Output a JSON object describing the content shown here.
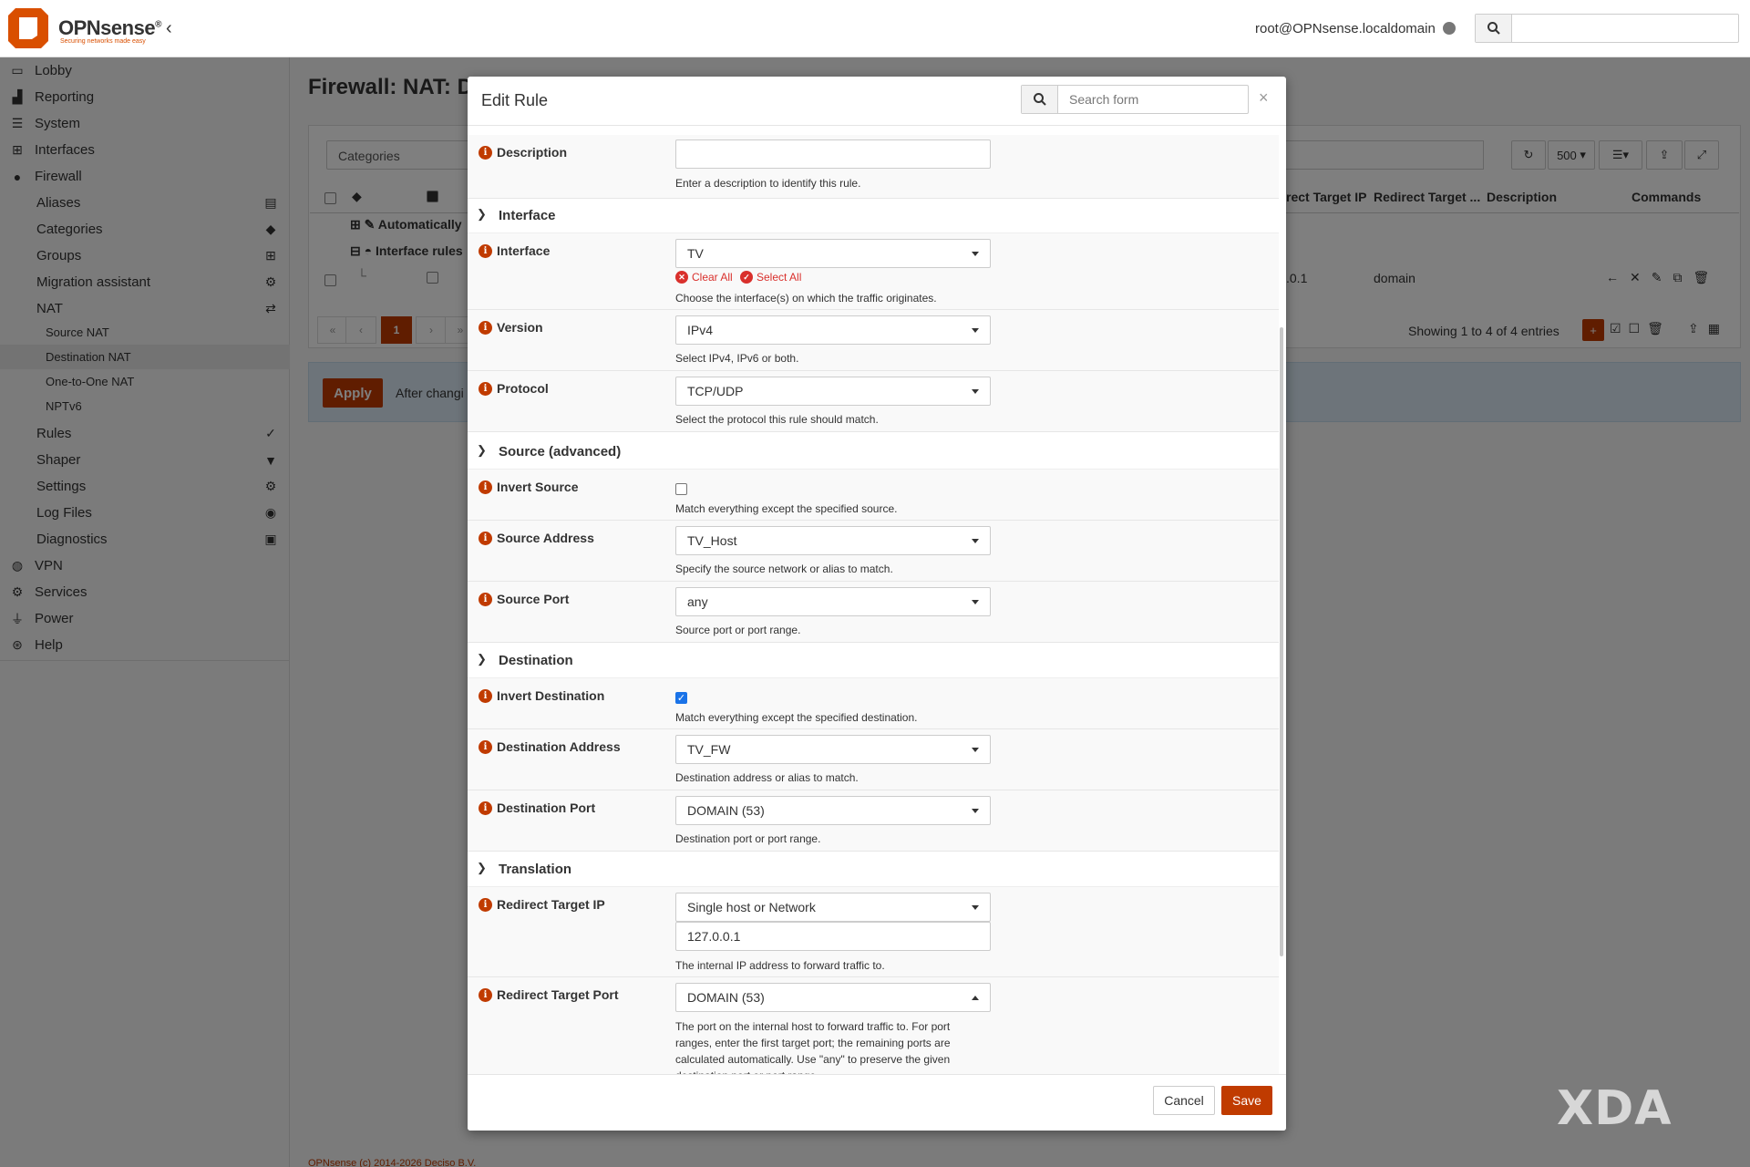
{
  "header": {
    "brand": "OPNsense",
    "brand_mark": "®",
    "tagline": "Securing networks made easy",
    "user": "root@OPNsense.localdomain"
  },
  "sidebar": {
    "items": [
      {
        "label": "Lobby"
      },
      {
        "label": "Reporting"
      },
      {
        "label": "System"
      },
      {
        "label": "Interfaces"
      },
      {
        "label": "Firewall"
      },
      {
        "label": "Aliases"
      },
      {
        "label": "Categories"
      },
      {
        "label": "Groups"
      },
      {
        "label": "Migration assistant"
      },
      {
        "label": "NAT"
      },
      {
        "label": "Source NAT"
      },
      {
        "label": "Destination NAT"
      },
      {
        "label": "One-to-One NAT"
      },
      {
        "label": "NPTv6"
      },
      {
        "label": "Rules"
      },
      {
        "label": "Shaper"
      },
      {
        "label": "Settings"
      },
      {
        "label": "Log Files"
      },
      {
        "label": "Diagnostics"
      },
      {
        "label": "VPN"
      },
      {
        "label": "Services"
      },
      {
        "label": "Power"
      },
      {
        "label": "Help"
      }
    ]
  },
  "main": {
    "title": "Firewall: NAT: De",
    "categories_placeholder": "Categories",
    "page_size": "500",
    "columns": [
      "rect Target IP",
      "Redirect Target ...",
      "Description",
      "Commands"
    ],
    "group_rows": [
      "Automatically",
      "Interface rules"
    ],
    "row": {
      "target_ip": ".0.1",
      "redirect_target": "domain"
    },
    "pagination": {
      "first": "«",
      "prev": "‹",
      "current": "1",
      "next": "›",
      "last": "»"
    },
    "showing": "Showing 1 to 4 of 4 entries",
    "apply_label": "Apply",
    "apply_text": "After changi",
    "footer": "OPNsense (c) 2014-2026 Deciso B.V."
  },
  "modal": {
    "title": "Edit Rule",
    "search_placeholder": "Search form",
    "close": "×",
    "description": {
      "label": "Description",
      "value": "",
      "help": "Enter a description to identify this rule."
    },
    "sections": {
      "interface": "Interface",
      "source": "Source (advanced)",
      "destination": "Destination",
      "translation": "Translation"
    },
    "interface": {
      "label": "Interface",
      "value": "TV",
      "clear_all": "Clear All",
      "select_all": "Select All",
      "help": "Choose the interface(s) on which the traffic originates."
    },
    "version": {
      "label": "Version",
      "value": "IPv4",
      "help": "Select IPv4, IPv6 or both."
    },
    "protocol": {
      "label": "Protocol",
      "value": "TCP/UDP",
      "help": "Select the protocol this rule should match."
    },
    "invert_source": {
      "label": "Invert Source",
      "checked": false,
      "help": "Match everything except the specified source."
    },
    "source_address": {
      "label": "Source Address",
      "value": "TV_Host",
      "help": "Specify the source network or alias to match."
    },
    "source_port": {
      "label": "Source Port",
      "value": "any",
      "help": "Source port or port range."
    },
    "invert_destination": {
      "label": "Invert Destination",
      "checked": true,
      "help": "Match everything except the specified destination."
    },
    "destination_address": {
      "label": "Destination Address",
      "value": "TV_FW",
      "help": "Destination address or alias to match."
    },
    "destination_port": {
      "label": "Destination Port",
      "value": "DOMAIN (53)",
      "help": "Destination port or port range."
    },
    "redirect_ip": {
      "label": "Redirect Target IP",
      "type_value": "Single host or Network",
      "value": "127.0.0.1",
      "help": "The internal IP address to forward traffic to."
    },
    "redirect_port": {
      "label": "Redirect Target Port",
      "value": "DOMAIN (53)",
      "help": "The port on the internal host to forward traffic to. For port ranges, enter the first target port; the remaining ports are calculated automatically. Use \"any\" to preserve the given destination port or port range."
    },
    "cancel_label": "Cancel",
    "save_label": "Save"
  },
  "watermark": "XDA",
  "colors": {
    "accent": "#c03b00",
    "link_red": "#d9302c",
    "checkbox": "#1a73e8"
  }
}
